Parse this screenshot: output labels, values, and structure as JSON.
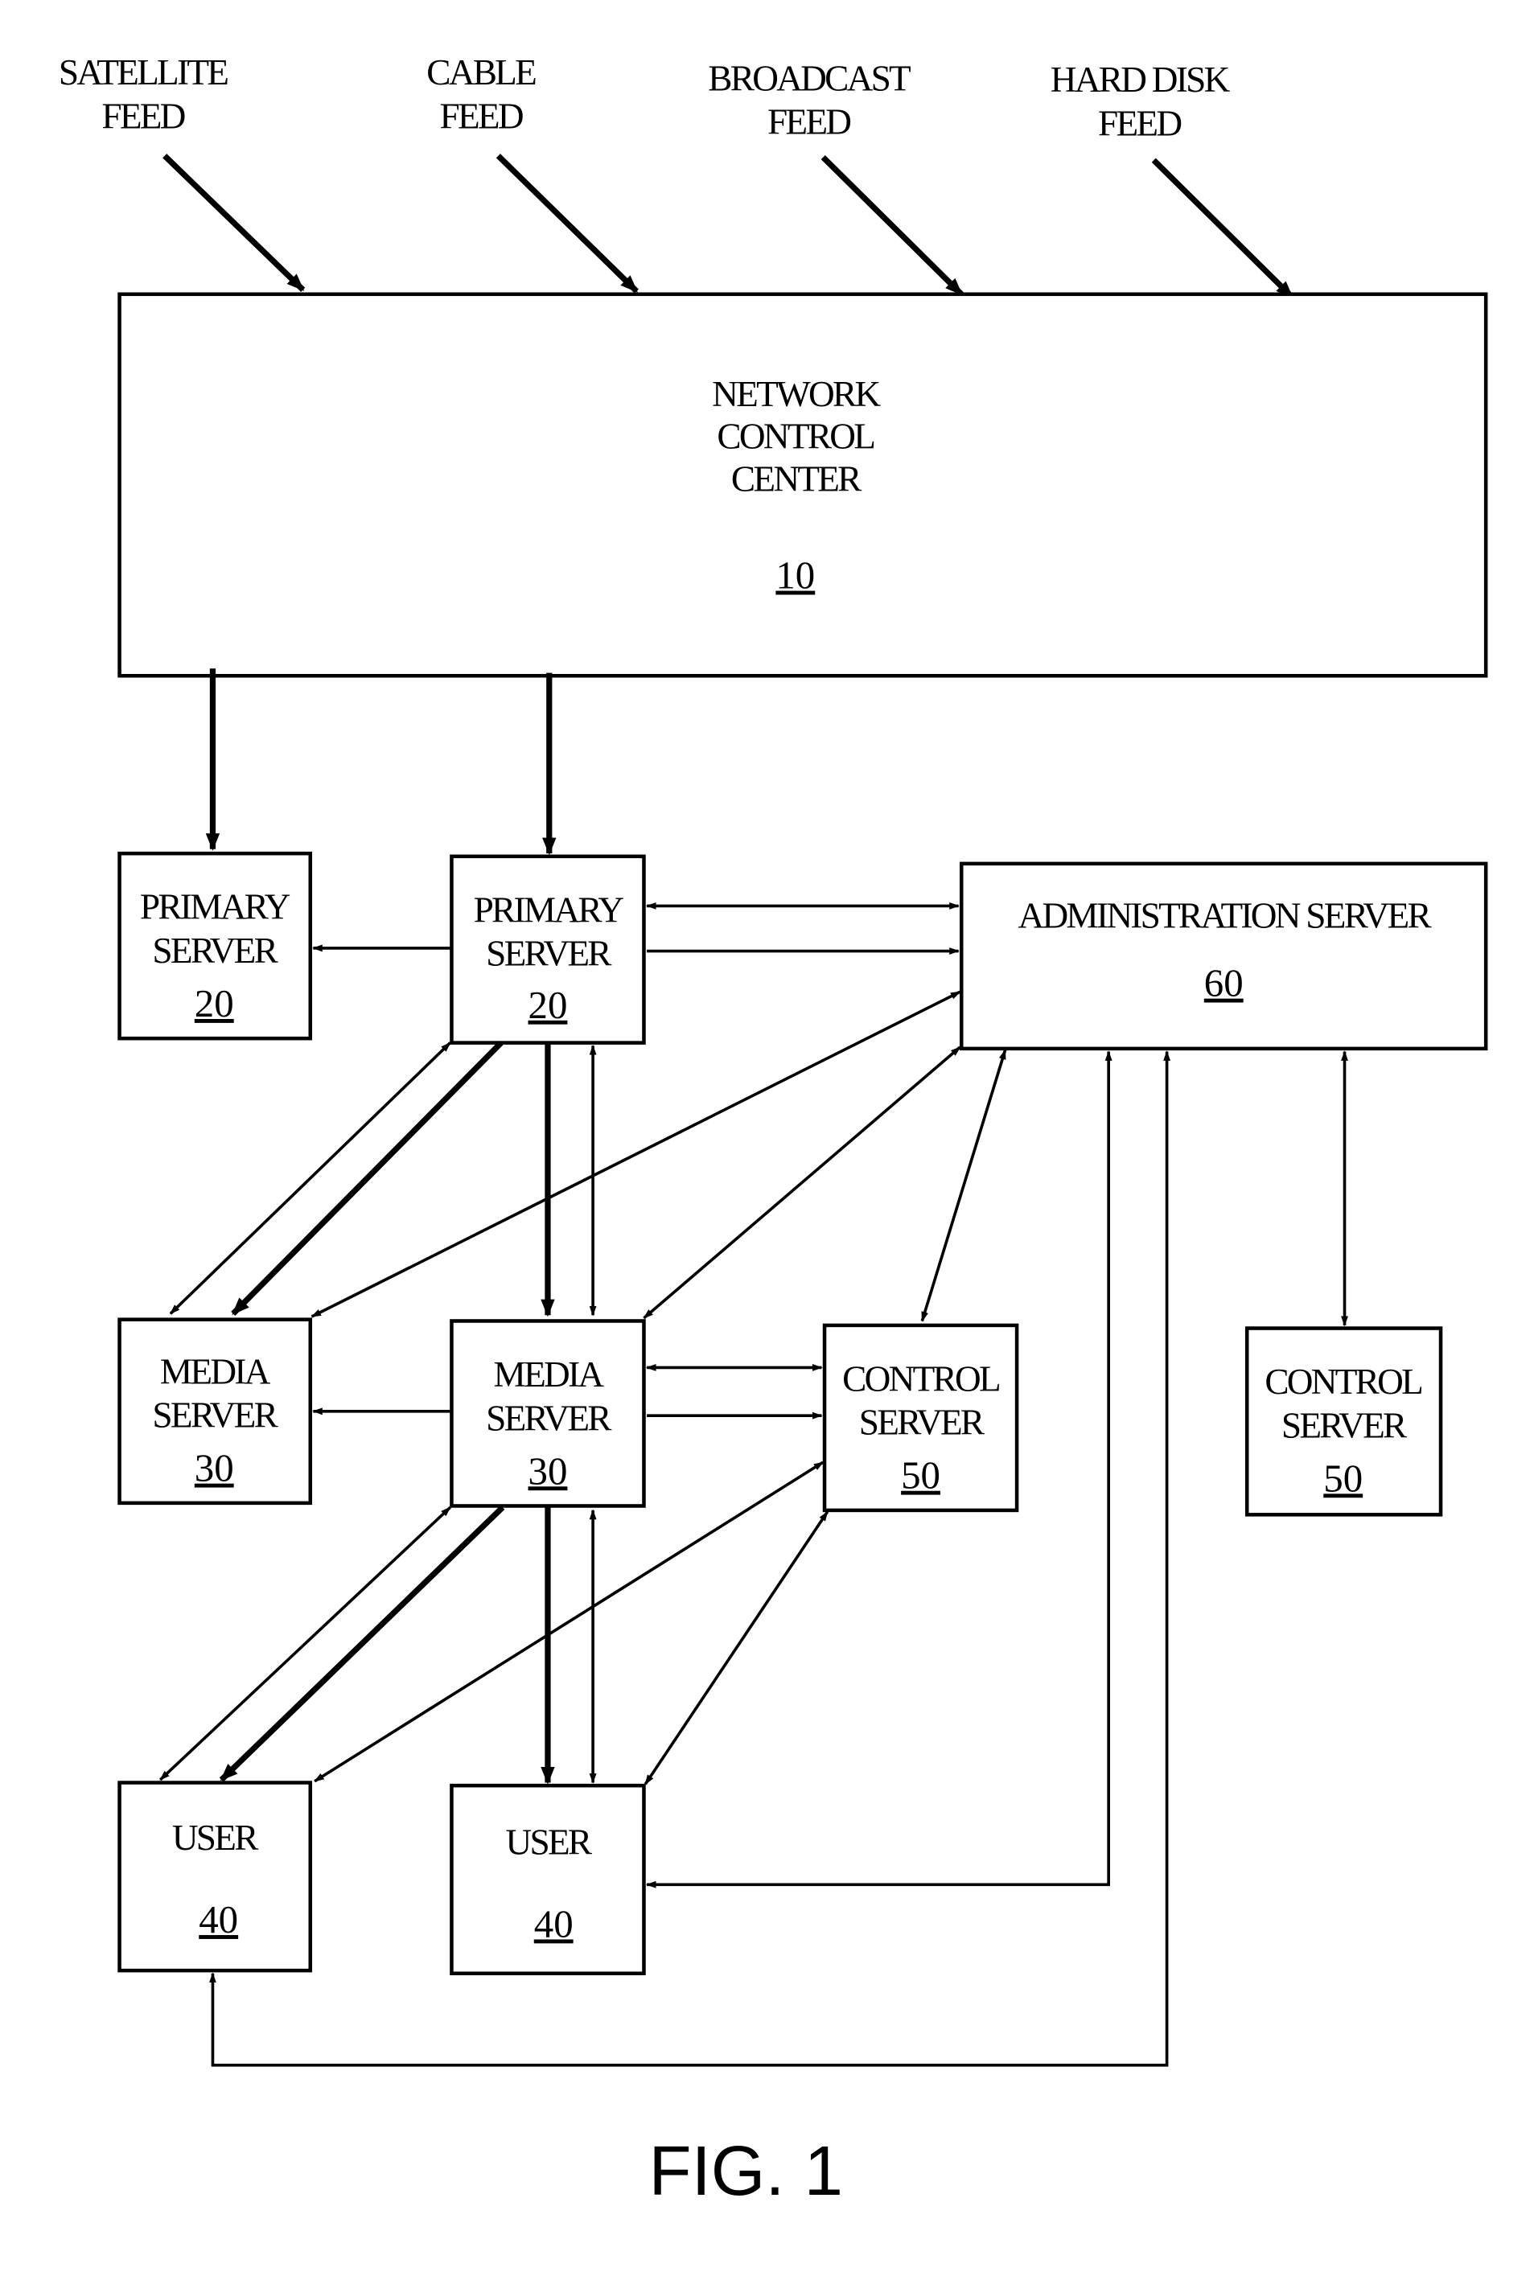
{
  "figure_label": "FIG. 1",
  "feeds": [
    {
      "line1": "SATELLITE",
      "line2": "FEED"
    },
    {
      "line1": "CABLE",
      "line2": "FEED"
    },
    {
      "line1": "BROADCAST",
      "line2": "FEED"
    },
    {
      "line1": "HARD DISK",
      "line2": "FEED"
    }
  ],
  "network_control_center": {
    "lines": [
      "NETWORK",
      "CONTROL",
      "CENTER"
    ],
    "ref": "10"
  },
  "primary_servers": [
    {
      "lines": [
        "PRIMARY",
        "SERVER"
      ],
      "ref": "20"
    },
    {
      "lines": [
        "PRIMARY",
        "SERVER"
      ],
      "ref": "20"
    }
  ],
  "administration_server": {
    "label": "ADMINISTRATION SERVER",
    "ref": "60"
  },
  "media_servers": [
    {
      "lines": [
        "MEDIA",
        "SERVER"
      ],
      "ref": "30"
    },
    {
      "lines": [
        "MEDIA",
        "SERVER"
      ],
      "ref": "30"
    }
  ],
  "control_servers": [
    {
      "lines": [
        "CONTROL",
        "SERVER"
      ],
      "ref": "50"
    },
    {
      "lines": [
        "CONTROL",
        "SERVER"
      ],
      "ref": "50"
    }
  ],
  "users": [
    {
      "label": "USER",
      "ref": "40"
    },
    {
      "label": "USER",
      "ref": "40"
    }
  ]
}
